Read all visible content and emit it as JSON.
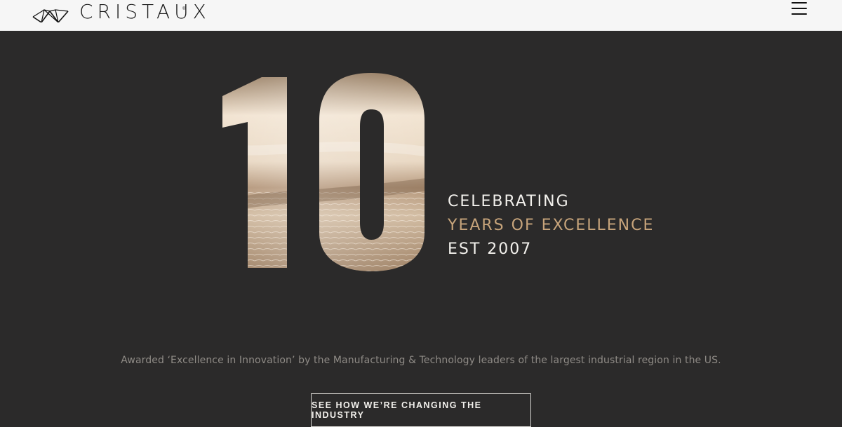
{
  "header": {
    "logo_text": "CRISTAUX",
    "logo_trademark": "®",
    "menu_icon": "hamburger-menu-icon"
  },
  "hero": {
    "big_number": "10",
    "headline": {
      "line_1": "CELEBRATING",
      "line_2": "YEARS OF EXCELLENCE",
      "line_3": "EST 2007"
    },
    "award_text": "Awarded ‘Excellence in Innovation’ by the Manufacturing & Technology leaders of the largest industrial region in the US.",
    "cta_label": "SEE HOW WE’RE CHANGING THE INDUSTRY"
  },
  "colors": {
    "header_background": "#f6f6f6",
    "page_background": "#2b2a2a",
    "accent_gold": "#c7a47b",
    "text_light": "#f2f0ec",
    "text_muted": "#8f8b86"
  }
}
